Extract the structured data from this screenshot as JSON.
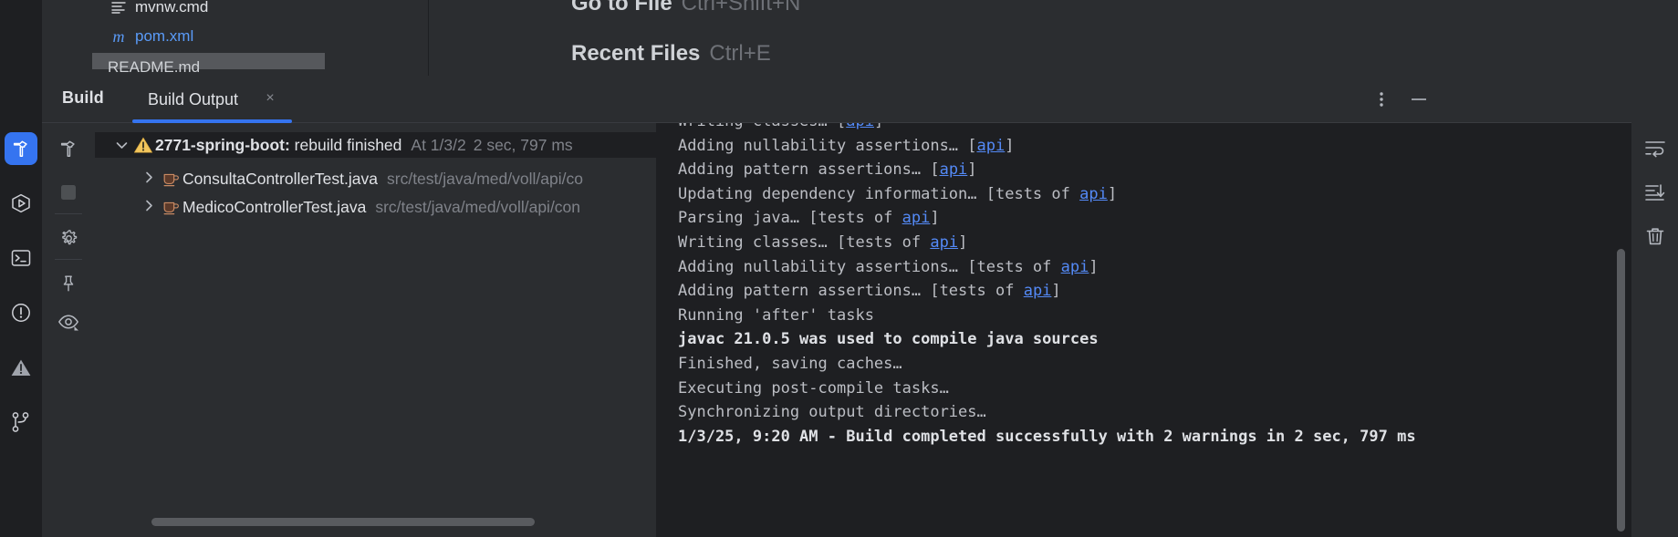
{
  "project_panel": {
    "files": [
      {
        "name": "mvnw.cmd",
        "icon": "text-file-icon"
      },
      {
        "name": "pom.xml",
        "icon": "maven-file-icon"
      },
      {
        "name": "README.md",
        "icon": "markdown-file-icon"
      }
    ]
  },
  "editor_peek": {
    "lines": [
      {
        "label": "Go to File",
        "shortcut": "Ctrl+Shift+N"
      },
      {
        "label": "Recent Files",
        "shortcut": "Ctrl+E"
      }
    ]
  },
  "build_window": {
    "title": "Build",
    "tab": {
      "label": "Build Output",
      "close": "×"
    },
    "header_actions": [
      {
        "name": "more-options",
        "glyph": "⋮"
      },
      {
        "name": "minimize",
        "glyph": "—"
      }
    ]
  },
  "left_rail": {
    "items": [
      {
        "name": "build-tool-icon",
        "label": "Build",
        "active": true
      },
      {
        "name": "run-tool-icon",
        "label": "Run",
        "active": false
      },
      {
        "name": "terminal-tool-icon",
        "label": "Terminal",
        "active": false
      },
      {
        "name": "problems-tool-icon",
        "label": "Problems",
        "active": false
      },
      {
        "name": "warning-tool-icon",
        "label": "Warnings",
        "active": false
      },
      {
        "name": "git-branch-tool-icon",
        "label": "Version Control",
        "active": false
      }
    ]
  },
  "tree_toolbar": {
    "items": [
      {
        "name": "build-hammer-icon",
        "label": "Rebuild"
      },
      {
        "name": "stop-square-icon",
        "label": "Stop"
      },
      {
        "name": "settings-gear-icon",
        "label": "Settings"
      },
      {
        "name": "pin-icon",
        "label": "Pin Tab"
      },
      {
        "name": "eye-icon",
        "label": "Show Warnings"
      }
    ]
  },
  "build_tree": {
    "root": {
      "icon": "warning-triangle-icon",
      "title_bold": "2771-spring-boot:",
      "title_rest": "rebuild finished",
      "meta_time": "At 1/3/2",
      "meta_duration": "2 sec, 797 ms",
      "expanded": true,
      "chevron": "⌄"
    },
    "children": [
      {
        "icon": "java-class-icon",
        "name": "ConsultaControllerTest.java",
        "path": "src/test/java/med/voll/api/co",
        "chevron": "›"
      },
      {
        "icon": "java-class-icon",
        "name": "MedicoControllerTest.java",
        "path": "src/test/java/med/voll/api/con",
        "chevron": "›"
      }
    ]
  },
  "console": {
    "lines": [
      {
        "text": "Writing classes… [api]",
        "bold": false,
        "clipped_top": true,
        "links": [
          "api"
        ]
      },
      {
        "text": "Adding nullability assertions… [api]",
        "bold": false,
        "links": [
          "api"
        ]
      },
      {
        "text": "Adding pattern assertions… [api]",
        "bold": false,
        "links": [
          "api"
        ]
      },
      {
        "text": "Updating dependency information… [tests of api]",
        "bold": false,
        "links": [
          "api"
        ]
      },
      {
        "text": "Parsing java… [tests of api]",
        "bold": false,
        "links": [
          "api"
        ]
      },
      {
        "text": "Writing classes… [tests of api]",
        "bold": false,
        "links": [
          "api"
        ]
      },
      {
        "text": "Adding nullability assertions… [tests of api]",
        "bold": false,
        "links": [
          "api"
        ]
      },
      {
        "text": "Adding pattern assertions… [tests of api]",
        "bold": false,
        "links": [
          "api"
        ]
      },
      {
        "text": "Running 'after' tasks",
        "bold": false,
        "links": []
      },
      {
        "text": "javac 21.0.5 was used to compile java sources",
        "bold": true,
        "links": []
      },
      {
        "text": "Finished, saving caches…",
        "bold": false,
        "links": []
      },
      {
        "text": "Executing post-compile tasks…",
        "bold": false,
        "links": []
      },
      {
        "text": "Synchronizing output directories…",
        "bold": false,
        "links": []
      },
      {
        "text": "1/3/25, 9:20 AM - Build completed successfully with 2 warnings in 2 sec, 797 ms",
        "bold": true,
        "links": []
      }
    ]
  },
  "console_rail": {
    "items": [
      {
        "name": "soft-wrap-icon",
        "label": "Soft-Wrap"
      },
      {
        "name": "scroll-to-end-icon",
        "label": "Scroll to End"
      },
      {
        "name": "trash-icon",
        "label": "Clear All"
      }
    ]
  },
  "colors": {
    "accent": "#3574f0",
    "panel_bg": "#2b2d30",
    "console_bg": "#1e1f22",
    "text": "#dfe1e5",
    "muted": "#7f8289",
    "link": "#548af7",
    "warning": "#f2c55c"
  }
}
